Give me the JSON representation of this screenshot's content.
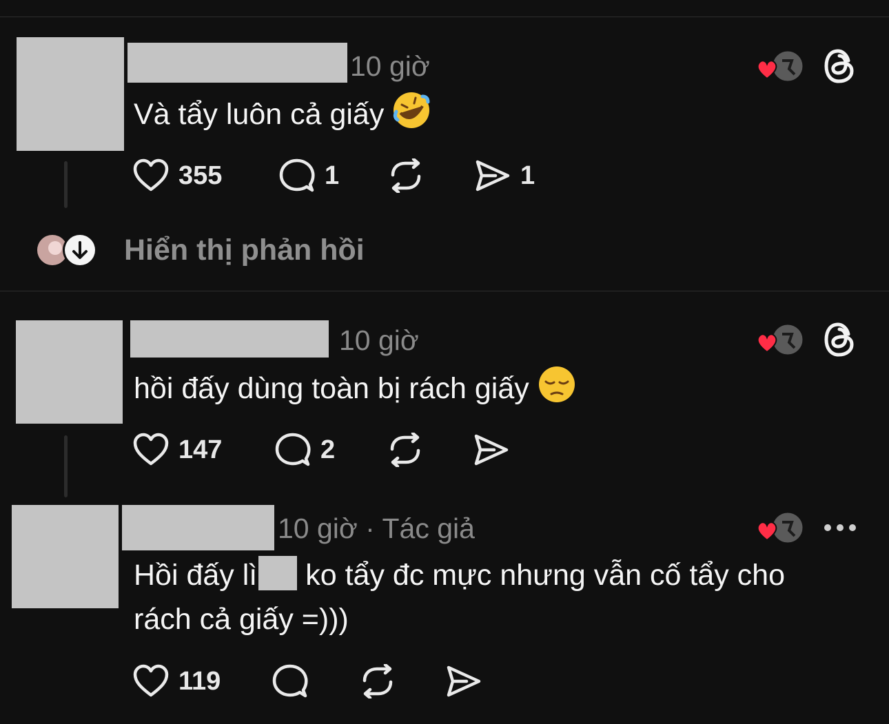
{
  "colors": {
    "background": "#101010",
    "muted": "#8a8a8a",
    "heart": "#ff2d46",
    "redaction": "#c4c4c4"
  },
  "comments": [
    {
      "time": "10 giờ",
      "text": "Và tẩy luôn cả giấy",
      "emoji": "rolling-on-floor-laughing-emoji",
      "likes": "355",
      "replies": "1",
      "reposts": "",
      "shares": "1",
      "corner_icon": "threads-logo-icon"
    },
    {
      "time": "10 giờ",
      "text": "hồi đấy dùng toàn bị rách giấy",
      "emoji": "pensive-face-emoji",
      "likes": "147",
      "replies": "2",
      "reposts": "",
      "shares": "",
      "corner_icon": "threads-logo-icon"
    },
    {
      "time": "10 giờ · Tác giả",
      "text_line1_a": "Hồi đấy lì",
      "text_line1_b": "ko tẩy đc mực nhưng vẫn cố tẩy cho",
      "text_line2": "rách cả giấy =)))",
      "likes": "119",
      "replies": "",
      "reposts": "",
      "shares": "",
      "corner_icon": "more-icon"
    }
  ],
  "show_replies": {
    "label": "Hiển thị phản hồi"
  }
}
